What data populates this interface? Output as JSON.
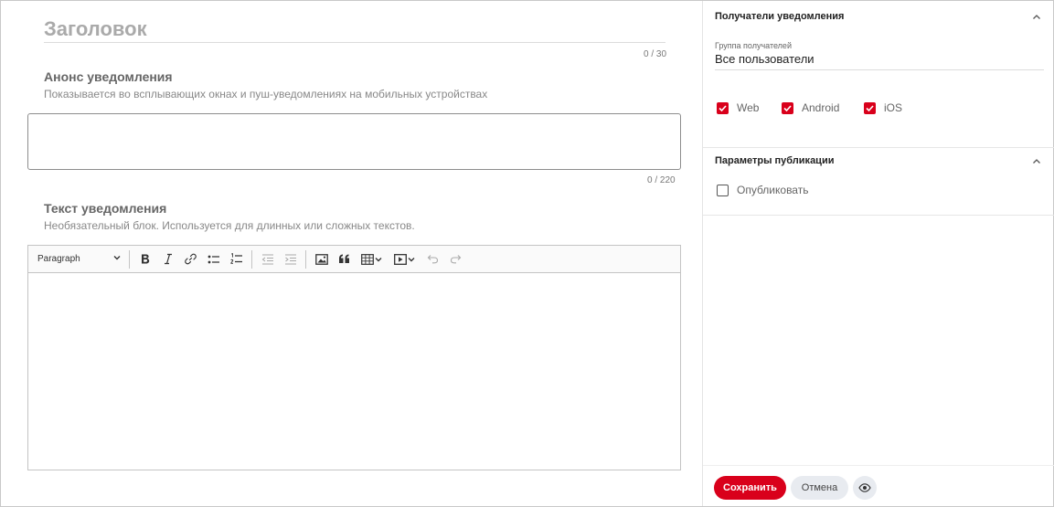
{
  "title": {
    "placeholder": "Заголовок",
    "counter": "0 / 30"
  },
  "announce": {
    "heading": "Анонс уведомления",
    "hint": "Показывается во всплывающих окнах и пуш-уведомлениях на мобильных устройствах",
    "counter": "0 / 220"
  },
  "body_text": {
    "heading": "Текст уведомления",
    "hint": "Необязательный блок. Используется для длинных или сложных текстов."
  },
  "toolbar": {
    "paragraph_label": "Paragraph",
    "icons": [
      "bold-icon",
      "italic-icon",
      "link-icon",
      "bulleted-list-icon",
      "numbered-list-icon",
      "outdent-icon",
      "indent-icon",
      "image-icon",
      "blockquote-icon",
      "table-icon",
      "media-icon",
      "undo-icon",
      "redo-icon"
    ]
  },
  "recipients": {
    "heading": "Получатели уведомления",
    "group_label": "Группа получателей",
    "group_value": "Все пользователи",
    "platforms": [
      {
        "label": "Web",
        "checked": true
      },
      {
        "label": "Android",
        "checked": true
      },
      {
        "label": "iOS",
        "checked": true
      }
    ]
  },
  "publication": {
    "heading": "Параметры публикации",
    "publish_label": "Опубликовать",
    "publish_checked": false
  },
  "actions": {
    "save_label": "Сохранить",
    "cancel_label": "Отмена"
  },
  "colors": {
    "accent": "#d9001b",
    "secondary_button": "#e8ebf0"
  }
}
